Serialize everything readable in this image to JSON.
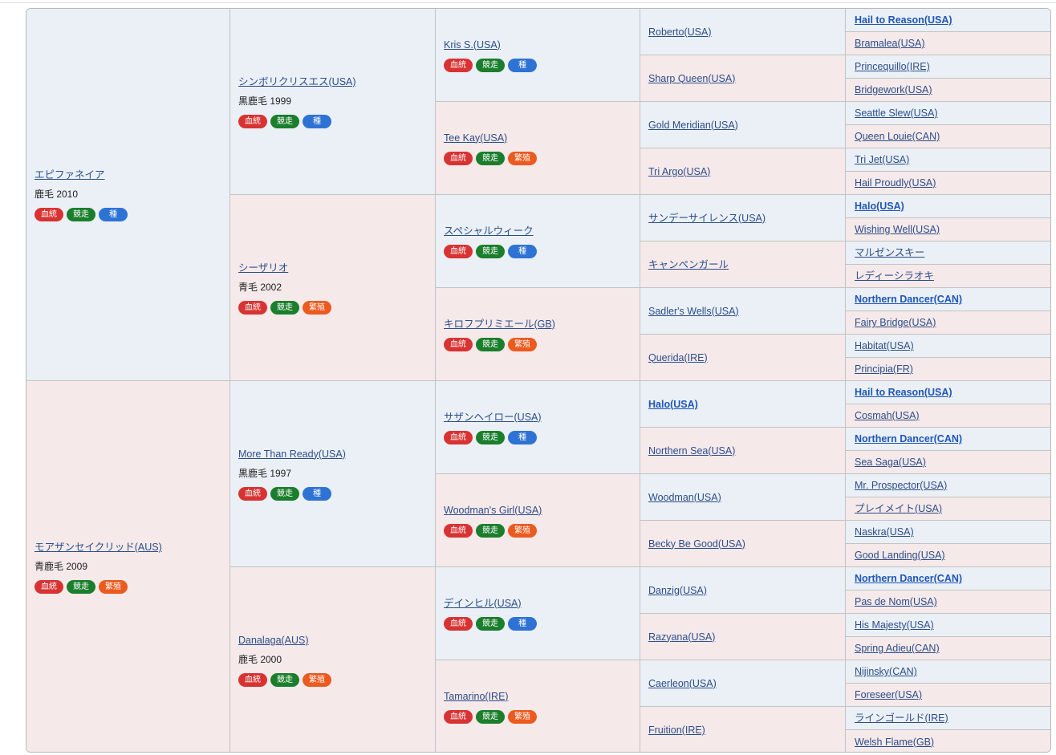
{
  "badge_labels": {
    "pedigree": "血統",
    "race": "競走",
    "stud": "種",
    "breed": "繁殖"
  },
  "colors": {
    "male_bg": "#eaf0f5",
    "female_bg": "#f5e9e9",
    "link": "#2c4d8a",
    "badge_pedigree": "#d83333",
    "badge_race": "#1a7e2c",
    "badge_stud": "#2e73d4",
    "badge_breed": "#ec5a1f"
  },
  "gen1": [
    {
      "name": "エピファネイア",
      "info": "鹿毛 2010",
      "badges": [
        "pedigree",
        "race",
        "stud"
      ]
    },
    {
      "name": "モアザンセイクリッド(AUS)",
      "info": "青鹿毛 2009",
      "badges": [
        "pedigree",
        "race",
        "breed"
      ]
    }
  ],
  "gen2": [
    {
      "name": "シンボリクリスエス(USA)",
      "info": "黒鹿毛 1999",
      "badges": [
        "pedigree",
        "race",
        "stud"
      ]
    },
    {
      "name": "シーザリオ",
      "info": "青毛 2002",
      "badges": [
        "pedigree",
        "race",
        "breed"
      ]
    },
    {
      "name": "More Than Ready(USA)",
      "info": "黒鹿毛 1997",
      "badges": [
        "pedigree",
        "race",
        "stud"
      ]
    },
    {
      "name": "Danalaga(AUS)",
      "info": "鹿毛 2000",
      "badges": [
        "pedigree",
        "race",
        "breed"
      ]
    }
  ],
  "gen3": [
    {
      "name": "Kris S.(USA)",
      "badges": [
        "pedigree",
        "race",
        "stud"
      ]
    },
    {
      "name": "Tee Kay(USA)",
      "badges": [
        "pedigree",
        "race",
        "breed"
      ]
    },
    {
      "name": "スペシャルウィーク",
      "badges": [
        "pedigree",
        "race",
        "stud"
      ]
    },
    {
      "name": "キロフプリミエール(GB)",
      "badges": [
        "pedigree",
        "race",
        "breed"
      ]
    },
    {
      "name": "サザンヘイロー(USA)",
      "badges": [
        "pedigree",
        "race",
        "stud"
      ]
    },
    {
      "name": "Woodman's Girl(USA)",
      "badges": [
        "pedigree",
        "race",
        "breed"
      ]
    },
    {
      "name": "デインヒル(USA)",
      "badges": [
        "pedigree",
        "race",
        "stud"
      ]
    },
    {
      "name": "Tamarino(IRE)",
      "badges": [
        "pedigree",
        "race",
        "breed"
      ]
    }
  ],
  "gen4": [
    {
      "name": "Roberto(USA)",
      "bold": false
    },
    {
      "name": "Sharp Queen(USA)",
      "bold": false
    },
    {
      "name": "Gold Meridian(USA)",
      "bold": false
    },
    {
      "name": "Tri Argo(USA)",
      "bold": false
    },
    {
      "name": "サンデーサイレンス(USA)",
      "bold": false
    },
    {
      "name": "キャンペンガール",
      "bold": false
    },
    {
      "name": "Sadler's Wells(USA)",
      "bold": false
    },
    {
      "name": "Querida(IRE)",
      "bold": false
    },
    {
      "name": "Halo(USA)",
      "bold": true
    },
    {
      "name": "Northern Sea(USA)",
      "bold": false
    },
    {
      "name": "Woodman(USA)",
      "bold": false
    },
    {
      "name": "Becky Be Good(USA)",
      "bold": false
    },
    {
      "name": "Danzig(USA)",
      "bold": false
    },
    {
      "name": "Razyana(USA)",
      "bold": false
    },
    {
      "name": "Caerleon(USA)",
      "bold": false
    },
    {
      "name": "Fruition(IRE)",
      "bold": false
    }
  ],
  "gen5": [
    {
      "name": "Hail to Reason(USA)",
      "bold": true
    },
    {
      "name": "Bramalea(USA)",
      "bold": false
    },
    {
      "name": "Princequillo(IRE)",
      "bold": false
    },
    {
      "name": "Bridgework(USA)",
      "bold": false
    },
    {
      "name": "Seattle Slew(USA)",
      "bold": false
    },
    {
      "name": "Queen Louie(CAN)",
      "bold": false
    },
    {
      "name": "Tri Jet(USA)",
      "bold": false
    },
    {
      "name": "Hail Proudly(USA)",
      "bold": false
    },
    {
      "name": "Halo(USA)",
      "bold": true
    },
    {
      "name": "Wishing Well(USA)",
      "bold": false
    },
    {
      "name": "マルゼンスキー",
      "bold": false
    },
    {
      "name": "レディーシラオキ",
      "bold": false
    },
    {
      "name": "Northern Dancer(CAN)",
      "bold": true
    },
    {
      "name": "Fairy Bridge(USA)",
      "bold": false
    },
    {
      "name": "Habitat(USA)",
      "bold": false
    },
    {
      "name": "Principia(FR)",
      "bold": false
    },
    {
      "name": "Hail to Reason(USA)",
      "bold": true
    },
    {
      "name": "Cosmah(USA)",
      "bold": false
    },
    {
      "name": "Northern Dancer(CAN)",
      "bold": true
    },
    {
      "name": "Sea Saga(USA)",
      "bold": false
    },
    {
      "name": "Mr. Prospector(USA)",
      "bold": false
    },
    {
      "name": "プレイメイト(USA)",
      "bold": false
    },
    {
      "name": "Naskra(USA)",
      "bold": false
    },
    {
      "name": "Good Landing(USA)",
      "bold": false
    },
    {
      "name": "Northern Dancer(CAN)",
      "bold": true
    },
    {
      "name": "Pas de Nom(USA)",
      "bold": false
    },
    {
      "name": "His Majesty(USA)",
      "bold": false
    },
    {
      "name": "Spring Adieu(CAN)",
      "bold": false
    },
    {
      "name": "Nijinsky(CAN)",
      "bold": false
    },
    {
      "name": "Foreseer(USA)",
      "bold": false
    },
    {
      "name": "ラインゴールド(IRE)",
      "bold": false
    },
    {
      "name": "Welsh Flame(GB)",
      "bold": false
    }
  ]
}
